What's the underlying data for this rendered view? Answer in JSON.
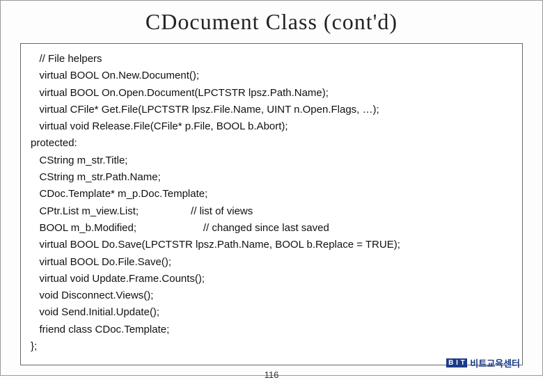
{
  "title": "CDocument Class (cont'd)",
  "code_lines": [
    "   // File helpers",
    "   virtual BOOL On.New.Document();",
    "   virtual BOOL On.Open.Document(LPCTSTR lpsz.Path.Name);",
    "   virtual CFile* Get.File(LPCTSTR lpsz.File.Name, UINT n.Open.Flags, …);",
    "   virtual void Release.File(CFile* p.File, BOOL b.Abort);",
    "protected:",
    "   CString m_str.Title;",
    "   CString m_str.Path.Name;",
    "   CDoc.Template* m_p.Doc.Template;",
    "   CPtr.List m_view.List;                  // list of views",
    "   BOOL m_b.Modified;                       // changed since last saved",
    "   virtual BOOL Do.Save(LPCTSTR lpsz.Path.Name, BOOL b.Replace = TRUE);",
    "   virtual BOOL Do.File.Save();",
    "   virtual void Update.Frame.Counts();",
    "   void Disconnect.Views();",
    "   void Send.Initial.Update();",
    "   friend class CDoc.Template;",
    "};"
  ],
  "page_number": "116",
  "brand_badge": "B I T",
  "brand_text": "비트교육센터"
}
